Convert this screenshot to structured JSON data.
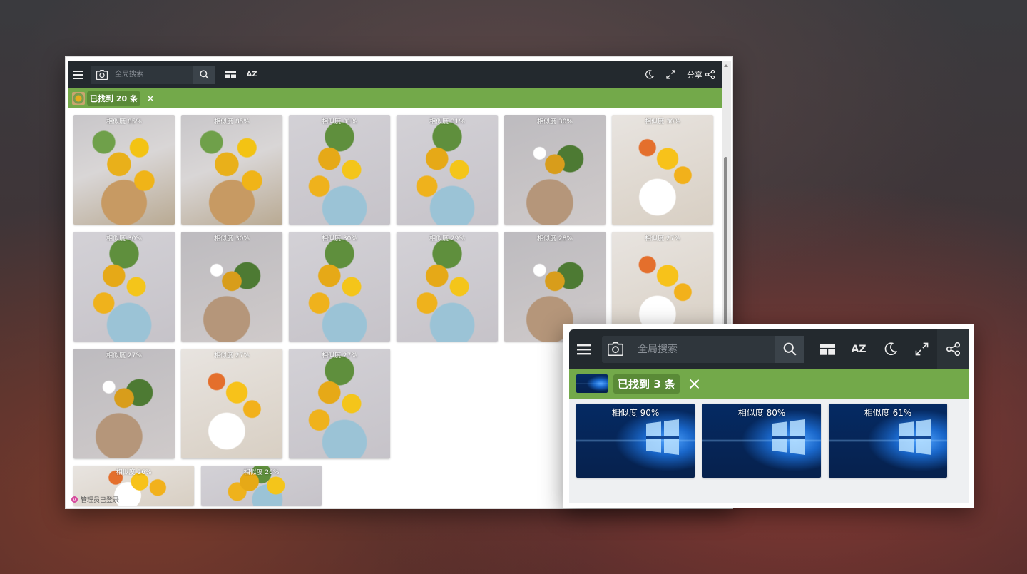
{
  "main_window": {
    "search_placeholder": "全局搜索",
    "share_label": "分享",
    "found_text": "已找到 20 条",
    "status_text": "管理员已登录",
    "results": [
      {
        "similarity": "相似度 85%"
      },
      {
        "similarity": "相似度 85%"
      },
      {
        "similarity": "相似度 31%"
      },
      {
        "similarity": "相似度 31%"
      },
      {
        "similarity": "相似度 30%"
      },
      {
        "similarity": "相似度 30%"
      },
      {
        "similarity": "相似度 30%"
      },
      {
        "similarity": "相似度 30%"
      },
      {
        "similarity": "相似度 30%"
      },
      {
        "similarity": "相似度 29%"
      },
      {
        "similarity": "相似度 28%"
      },
      {
        "similarity": "相似度 27%"
      },
      {
        "similarity": "相似度 27%"
      },
      {
        "similarity": "相似度 27%"
      },
      {
        "similarity": "相似度 27%"
      },
      {
        "similarity": "相似度 26%"
      },
      {
        "similarity": "相似度 26%"
      },
      {
        "similarity": "相似度 26%"
      }
    ]
  },
  "small_window": {
    "search_placeholder": "全局搜索",
    "found_text": "已找到 3 条",
    "results": [
      {
        "similarity": "相似度 90%"
      },
      {
        "similarity": "相似度 80%"
      },
      {
        "similarity": "相似度 61%"
      }
    ]
  },
  "icons": {
    "menu": "menu-icon",
    "camera": "camera-icon",
    "search": "search-icon",
    "layout": "layout-icon",
    "sort": "sort-az-icon",
    "theme": "moon-icon",
    "fullscreen": "expand-icon",
    "share": "share-icon",
    "close": "close-icon"
  },
  "colors": {
    "toolbar": "#23292e",
    "result_bar": "#73a94a",
    "status_dot": "#d64a9d"
  }
}
